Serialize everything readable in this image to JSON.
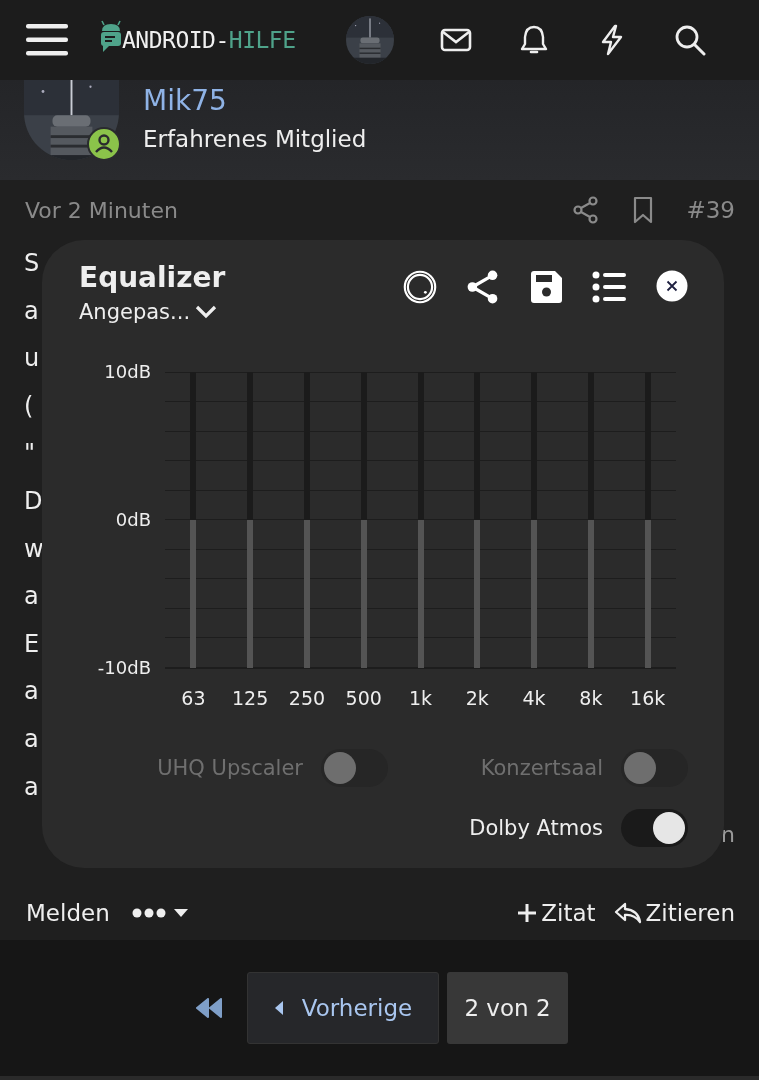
{
  "header": {
    "logo": {
      "text": "ANDROID-",
      "accent": "HILFE"
    }
  },
  "user": {
    "name": "Mik75",
    "role": "Erfahrenes Mitglied",
    "online": true
  },
  "post": {
    "time": "Vor 2 Minuten",
    "number": "#39",
    "lines": [
      "S",
      "a",
      "u",
      "(",
      "\"",
      "D",
      "w",
      "a",
      "E",
      "a",
      "a",
      "a"
    ],
    "line_end": "n",
    "report": "Melden",
    "quote": "Zitat",
    "reply": "Zitieren"
  },
  "equalizer": {
    "title": "Equalizer",
    "preset": "Angepas...",
    "y_labels": [
      "10dB",
      "0dB",
      "-10dB"
    ],
    "bands": [
      {
        "label": "63",
        "level": 0.5
      },
      {
        "label": "125",
        "level": 0.5
      },
      {
        "label": "250",
        "level": 0.5
      },
      {
        "label": "500",
        "level": 0.5
      },
      {
        "label": "1k",
        "level": 0.5
      },
      {
        "label": "2k",
        "level": 0.5
      },
      {
        "label": "4k",
        "level": 0.5
      },
      {
        "label": "8k",
        "level": 0.5
      },
      {
        "label": "16k",
        "level": 0.5
      }
    ],
    "toggles": [
      {
        "label": "UHQ Upscaler",
        "on": false,
        "disabled": true
      },
      {
        "label": "Konzertsaal",
        "on": false,
        "disabled": true
      },
      {
        "label": "Dolby Atmos",
        "on": true,
        "disabled": false
      }
    ]
  },
  "pagination": {
    "previous": "Vorherige",
    "page": "2 von 2"
  }
}
